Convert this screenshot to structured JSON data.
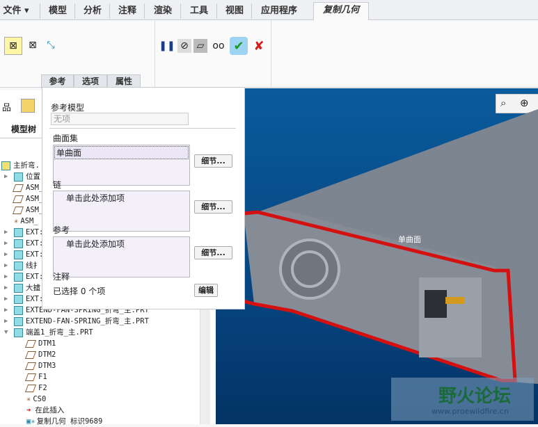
{
  "menubar": {
    "file": "文件",
    "tabs": [
      "模型",
      "分析",
      "注释",
      "渲染",
      "工具",
      "视图",
      "应用程序"
    ],
    "active_tab": "复制几何"
  },
  "ribbon": {
    "subtabs": [
      "参考",
      "选项",
      "属性"
    ]
  },
  "panel": {
    "ref_model_label": "参考模型",
    "ref_model_value": "无项",
    "surface_set_label": "曲面集",
    "surface_set_item": "单曲面",
    "chain_label": "链",
    "chain_placeholder": "单击此处添加项",
    "refs_label": "参考",
    "refs_placeholder": "单击此处添加项",
    "details_button": "细节...",
    "notes_label": "注释",
    "notes_status": "已选择 0 个项",
    "edit_button": "编辑"
  },
  "tree": {
    "title": "模型树",
    "items": [
      "主折弯.",
      "位置",
      "ASM_",
      "ASM_",
      "ASM_",
      "ASM_",
      "EXT:",
      "EXT:",
      "EXT:",
      "线扌",
      "EXT:",
      "大摣",
      "EXT:",
      "EXTEND-FAN-SPRING_折弯_主.PRT",
      "EXTEND-FAN-SPRING_折弯_主.PRT",
      "端盖1_折弯_主.PRT",
      "DTM1",
      "DTM2",
      "DTM3",
      "F1",
      "F2",
      "CS0",
      "在此插入",
      "复制几何 标识9689"
    ]
  },
  "viewport": {
    "surface_label": "单曲面",
    "watermark_title": "野火论坛",
    "watermark_url": "www.proewildfire.cn"
  }
}
